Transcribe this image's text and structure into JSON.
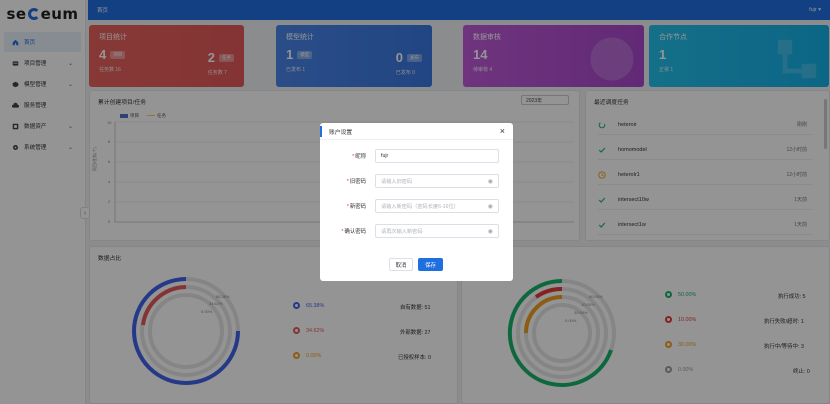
{
  "logo": {
    "text_left": "se",
    "text_right": "eum"
  },
  "sidebar": {
    "items": [
      {
        "label": "首页",
        "icon": "home-icon",
        "active": true,
        "expandable": false
      },
      {
        "label": "项目管理",
        "icon": "folder-icon",
        "active": false,
        "expandable": true
      },
      {
        "label": "模型管理",
        "icon": "cube-icon",
        "active": false,
        "expandable": true
      },
      {
        "label": "服务管理",
        "icon": "cloud-icon",
        "active": false,
        "expandable": false
      },
      {
        "label": "数据资产",
        "icon": "database-icon",
        "active": false,
        "expandable": true
      },
      {
        "label": "系统管理",
        "icon": "gear-icon",
        "active": false,
        "expandable": true
      }
    ]
  },
  "topbar": {
    "breadcrumb": "首页",
    "user": "fujr ▾"
  },
  "cards": [
    {
      "title": "项目统计",
      "value": "4",
      "tag": "项目",
      "sub": "任务数 16",
      "right_value": "2",
      "right_tag": "任务",
      "right_sub": "任务数 7",
      "color": "#e35a5a"
    },
    {
      "title": "模型统计",
      "value": "1",
      "tag": "模型",
      "sub": "已发布 1",
      "right_value": "0",
      "right_tag": "发布",
      "right_sub": "已发布 0",
      "color": "#3d7ee8"
    },
    {
      "title": "数据审核",
      "value": "14",
      "tag": "",
      "sub": "待审核 4",
      "color": "#b44fd0"
    },
    {
      "title": "合作节点",
      "value": "1",
      "tag": "",
      "sub": "正常 1",
      "color": "#19b7e8"
    }
  ],
  "chart_panel": {
    "title": "累计创建项目/任务",
    "year": "2023年",
    "legend": [
      "项目",
      "任务"
    ],
    "y_ticks": [
      "10",
      "8",
      "6",
      "4",
      "2",
      "0"
    ],
    "y_label": "项目/任务(个)"
  },
  "recent_tasks": {
    "title": "最近调度任务",
    "items": [
      {
        "name": "heteroir",
        "time": "刚刚",
        "status": "running"
      },
      {
        "name": "homomodel",
        "time": "12小时前",
        "status": "success"
      },
      {
        "name": "heterolr1",
        "time": "12小时前",
        "status": "waiting"
      },
      {
        "name": "intersect10w",
        "time": "1天前",
        "status": "success"
      },
      {
        "name": "intersect1w",
        "time": "1天前",
        "status": "success"
      }
    ]
  },
  "data_panel": {
    "title": "数据占比",
    "donut_labels": [
      "65.38%",
      "34.62%",
      "0.00%"
    ],
    "rows": [
      {
        "pct": "65.38%",
        "label": "自有数据: 51",
        "color": "#4263eb"
      },
      {
        "pct": "34.62%",
        "label": "外部数据: 27",
        "color": "#e35a5a"
      },
      {
        "pct": "0.00%",
        "label": "已授权样本: 0",
        "color": "#f0a020"
      }
    ]
  },
  "task_panel": {
    "donut_labels": [
      "60.00%",
      "10.00%",
      "30.00%",
      "0.00%"
    ],
    "rows": [
      {
        "pct": "50.00%",
        "label": "执行成功: 5",
        "color": "#19b36b"
      },
      {
        "pct": "10.00%",
        "label": "执行失败/超时: 1",
        "color": "#e53935"
      },
      {
        "pct": "30.00%",
        "label": "执行中/等待中: 3",
        "color": "#f0a020"
      },
      {
        "pct": "0.00%",
        "label": "终止: 0",
        "color": "#9e9e9e"
      }
    ]
  },
  "modal": {
    "title": "账户设置",
    "close": "×",
    "fields": [
      {
        "label": "昵称",
        "value": "fujr",
        "placeholder": "",
        "password": false
      },
      {
        "label": "旧密码",
        "value": "",
        "placeholder": "请输入旧密码",
        "password": true
      },
      {
        "label": "新密码",
        "value": "",
        "placeholder": "请输入新密码（密码长度6-16位）",
        "password": true
      },
      {
        "label": "确认密码",
        "value": "",
        "placeholder": "请再次输入新密码",
        "password": true
      }
    ],
    "cancel_label": "取消",
    "save_label": "保存",
    "required_mark": "*"
  },
  "colors": {
    "primary": "#1f6fe0",
    "danger": "#e53935"
  }
}
